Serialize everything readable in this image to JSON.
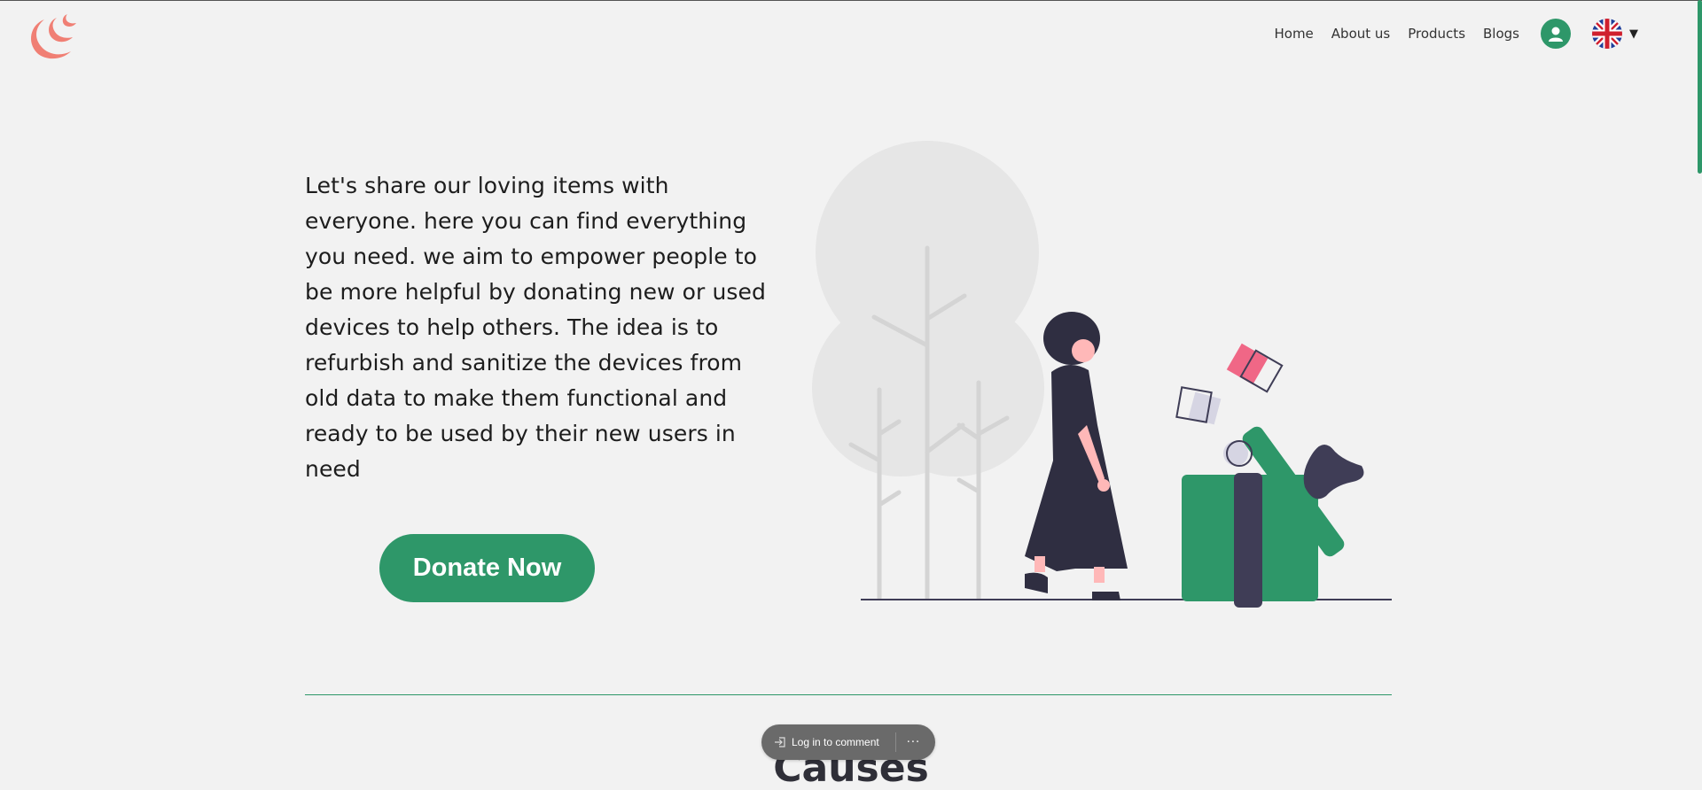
{
  "nav": {
    "items": [
      {
        "label": "Home"
      },
      {
        "label": "About us"
      },
      {
        "label": "Products"
      },
      {
        "label": "Blogs"
      }
    ],
    "language_caret": "▼"
  },
  "hero": {
    "text": "Let's share our loving items with everyone. here you can find everything you need. we aim to empower people to be more helpful by donating new or used devices to help others. The idea is to refurbish and sanitize the devices from old data to make them functional and ready to be used by their new users in need",
    "cta_label": "Donate Now"
  },
  "section": {
    "title": "Causes"
  },
  "comment_bar": {
    "login_label": "Log in to comment",
    "more_label": "···"
  },
  "colors": {
    "brand_green": "#2e9769",
    "logo_coral": "#f07f74",
    "background": "#f2f2f2"
  },
  "icons": [
    "logo-icon",
    "user-icon",
    "uk-flag-icon",
    "login-icon",
    "more-icon"
  ]
}
